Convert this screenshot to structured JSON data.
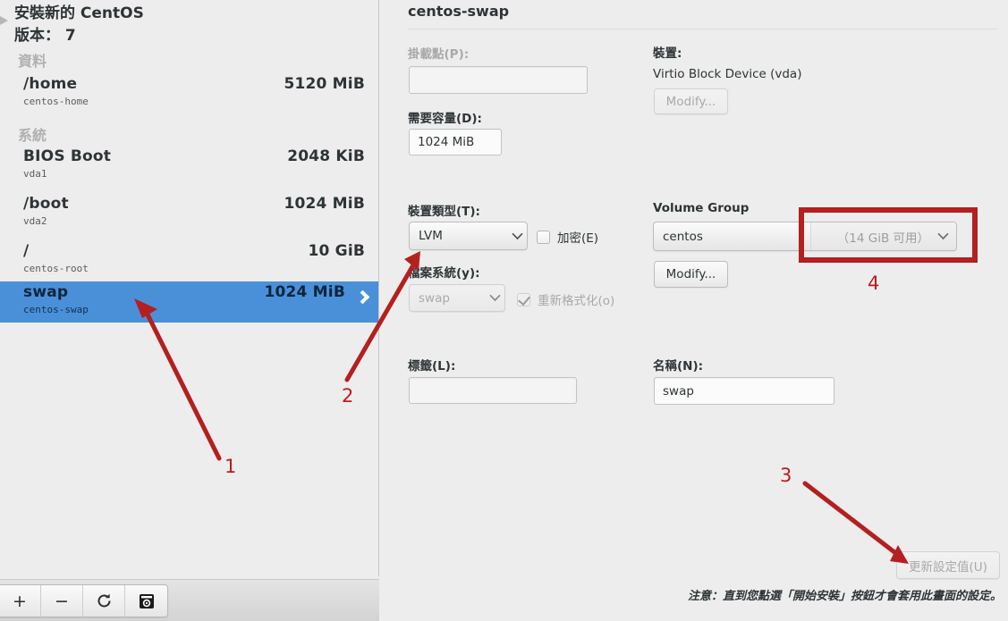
{
  "left_panel": {
    "install_title": "安裝新的 CentOS\n版本： 7",
    "collapse_icon": "triangle-right-icon",
    "groups": [
      {
        "header": "資料",
        "rows": [
          {
            "name": "/home",
            "sub": "centos-home",
            "size": "5120 MiB",
            "selected": false
          }
        ]
      },
      {
        "header": "系統",
        "rows": [
          {
            "name": "BIOS Boot",
            "sub": "vda1",
            "size": "2048 KiB",
            "selected": false
          },
          {
            "name": "/boot",
            "sub": "vda2",
            "size": "1024 MiB",
            "selected": false
          },
          {
            "name": "/",
            "sub": "centos-root",
            "size": "10 GiB",
            "selected": false
          },
          {
            "name": "swap",
            "sub": "centos-swap",
            "size": "1024 MiB",
            "selected": true
          }
        ]
      }
    ],
    "selection_color": "#4a90d9",
    "toolbar": [
      {
        "icon": "plus-icon",
        "label": "+"
      },
      {
        "icon": "minus-icon",
        "label": "−"
      },
      {
        "icon": "refresh-icon",
        "label": ""
      },
      {
        "icon": "disk-summary-icon",
        "label": ""
      }
    ]
  },
  "detail": {
    "title": "centos-swap",
    "mount_point": {
      "label": "掛載點(P):",
      "value": "",
      "disabled": true
    },
    "desired_capacity": {
      "label": "需要容量(D):",
      "value": "1024 MiB"
    },
    "device": {
      "label": "裝置:",
      "value": "Virtio Block Device (vda)",
      "modify_label": "Modify...",
      "modify_disabled": true
    },
    "device_type": {
      "label": "裝置類型(T):",
      "value": "LVM"
    },
    "encrypt": {
      "label": "加密(E)",
      "checked": false,
      "disabled": false
    },
    "file_system": {
      "label": "檔案系統(y):",
      "value": "swap",
      "disabled": true
    },
    "reformat": {
      "label": "重新格式化(o)",
      "checked": true,
      "disabled": true
    },
    "volume_group": {
      "label": "Volume Group",
      "name": "centos",
      "free_space": "（14 GiB 可用）",
      "modify_label": "Modify..."
    },
    "label_field": {
      "label": "標籤(L):",
      "value": ""
    },
    "name_field": {
      "label": "名稱(N):",
      "value": "swap"
    },
    "update_button": {
      "label": "更新設定值(U)",
      "disabled": true
    },
    "note": "注意：直到您點選「開始安裝」按鈕才會套用此畫面的設定。"
  },
  "annotations": {
    "color": "#b41f1f",
    "markers": [
      {
        "id": "1",
        "target": "swap-row"
      },
      {
        "id": "2",
        "target": "device-type-combo"
      },
      {
        "id": "3",
        "target": "update-settings-button"
      },
      {
        "id": "4",
        "target": "volume-group-free-space"
      }
    ]
  }
}
